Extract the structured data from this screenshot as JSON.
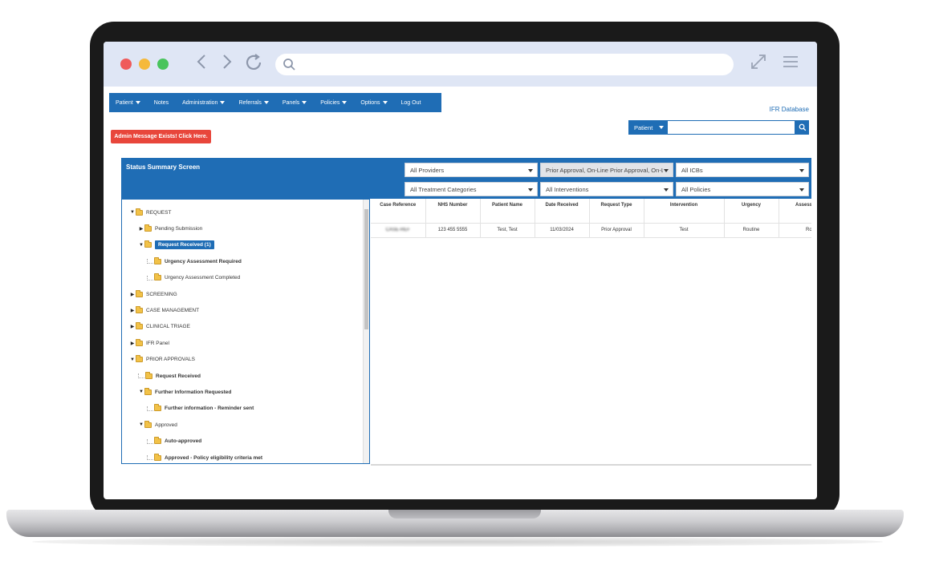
{
  "app": {
    "nav": [
      {
        "label": "Patient",
        "caret": true
      },
      {
        "label": "Notes",
        "caret": false
      },
      {
        "label": "Administration",
        "caret": true
      },
      {
        "label": "Referrals",
        "caret": true
      },
      {
        "label": "Panels",
        "caret": true
      },
      {
        "label": "Policies",
        "caret": true
      },
      {
        "label": "Options",
        "caret": true
      },
      {
        "label": "Log Out",
        "caret": false
      }
    ],
    "database_label": "IFR Database",
    "patient_search": {
      "select_label": "Patient",
      "value": ""
    },
    "admin_message": "Admin Message Exists! Click Here."
  },
  "status": {
    "title": "Status Summary Screen",
    "filters": {
      "providers": "All Providers",
      "request_types": "Prior Approval, On-Line Prior Approval, On-Li...",
      "icbs": "All ICBs",
      "treatment_categories": "All Treatment Categories",
      "interventions": "All Interventions",
      "policies": "All Policies"
    }
  },
  "tree": [
    {
      "label": "REQUEST",
      "toggle": "▼",
      "level": 0,
      "bold": false,
      "selected": false
    },
    {
      "label": "Pending Submission",
      "toggle": "▶",
      "level": 1,
      "bold": false,
      "selected": false
    },
    {
      "label": "Request Received (1)",
      "toggle": "▼",
      "level": 1,
      "bold": true,
      "selected": true
    },
    {
      "label": "Urgency Assessment Required",
      "toggle": "",
      "level": 2,
      "bold": true,
      "selected": false
    },
    {
      "label": "Urgency Assessment Completed",
      "toggle": "",
      "level": 2,
      "bold": false,
      "selected": false
    },
    {
      "label": "SCREENING",
      "toggle": "▶",
      "level": 0,
      "bold": false,
      "selected": false
    },
    {
      "label": "CASE MANAGEMENT",
      "toggle": "▶",
      "level": 0,
      "bold": false,
      "selected": false
    },
    {
      "label": "CLINICAL TRIAGE",
      "toggle": "▶",
      "level": 0,
      "bold": false,
      "selected": false
    },
    {
      "label": "IFR Panel",
      "toggle": "▶",
      "level": 0,
      "bold": false,
      "selected": false
    },
    {
      "label": "PRIOR APPROVALS",
      "toggle": "▼",
      "level": 0,
      "bold": false,
      "selected": false
    },
    {
      "label": "Request Received",
      "toggle": "",
      "level": 1,
      "bold": true,
      "selected": false
    },
    {
      "label": "Further Information Requested",
      "toggle": "▼",
      "level": 1,
      "bold": true,
      "selected": false
    },
    {
      "label": "Further information - Reminder sent",
      "toggle": "",
      "level": 2,
      "bold": true,
      "selected": false
    },
    {
      "label": "Approved",
      "toggle": "▼",
      "level": 1,
      "bold": false,
      "selected": false
    },
    {
      "label": "Auto-approved",
      "toggle": "",
      "level": 2,
      "bold": true,
      "selected": false
    },
    {
      "label": "Approved - Policy eligibility criteria met",
      "toggle": "",
      "level": 2,
      "bold": true,
      "selected": false
    }
  ],
  "table": {
    "columns": [
      "Case Reference",
      "NHS Number",
      "Patient Name",
      "Date Received",
      "Request Type",
      "Intervention",
      "Urgency",
      "Assess Urgen"
    ],
    "rows": [
      [
        "CASE-REF",
        "123 455 5555",
        "Test, Test",
        "11/03/2024",
        "Prior Approval",
        "Test",
        "Routine",
        "Routi"
      ]
    ]
  },
  "colors": {
    "brand": "#1f6db5",
    "alert": "#e8463b"
  }
}
